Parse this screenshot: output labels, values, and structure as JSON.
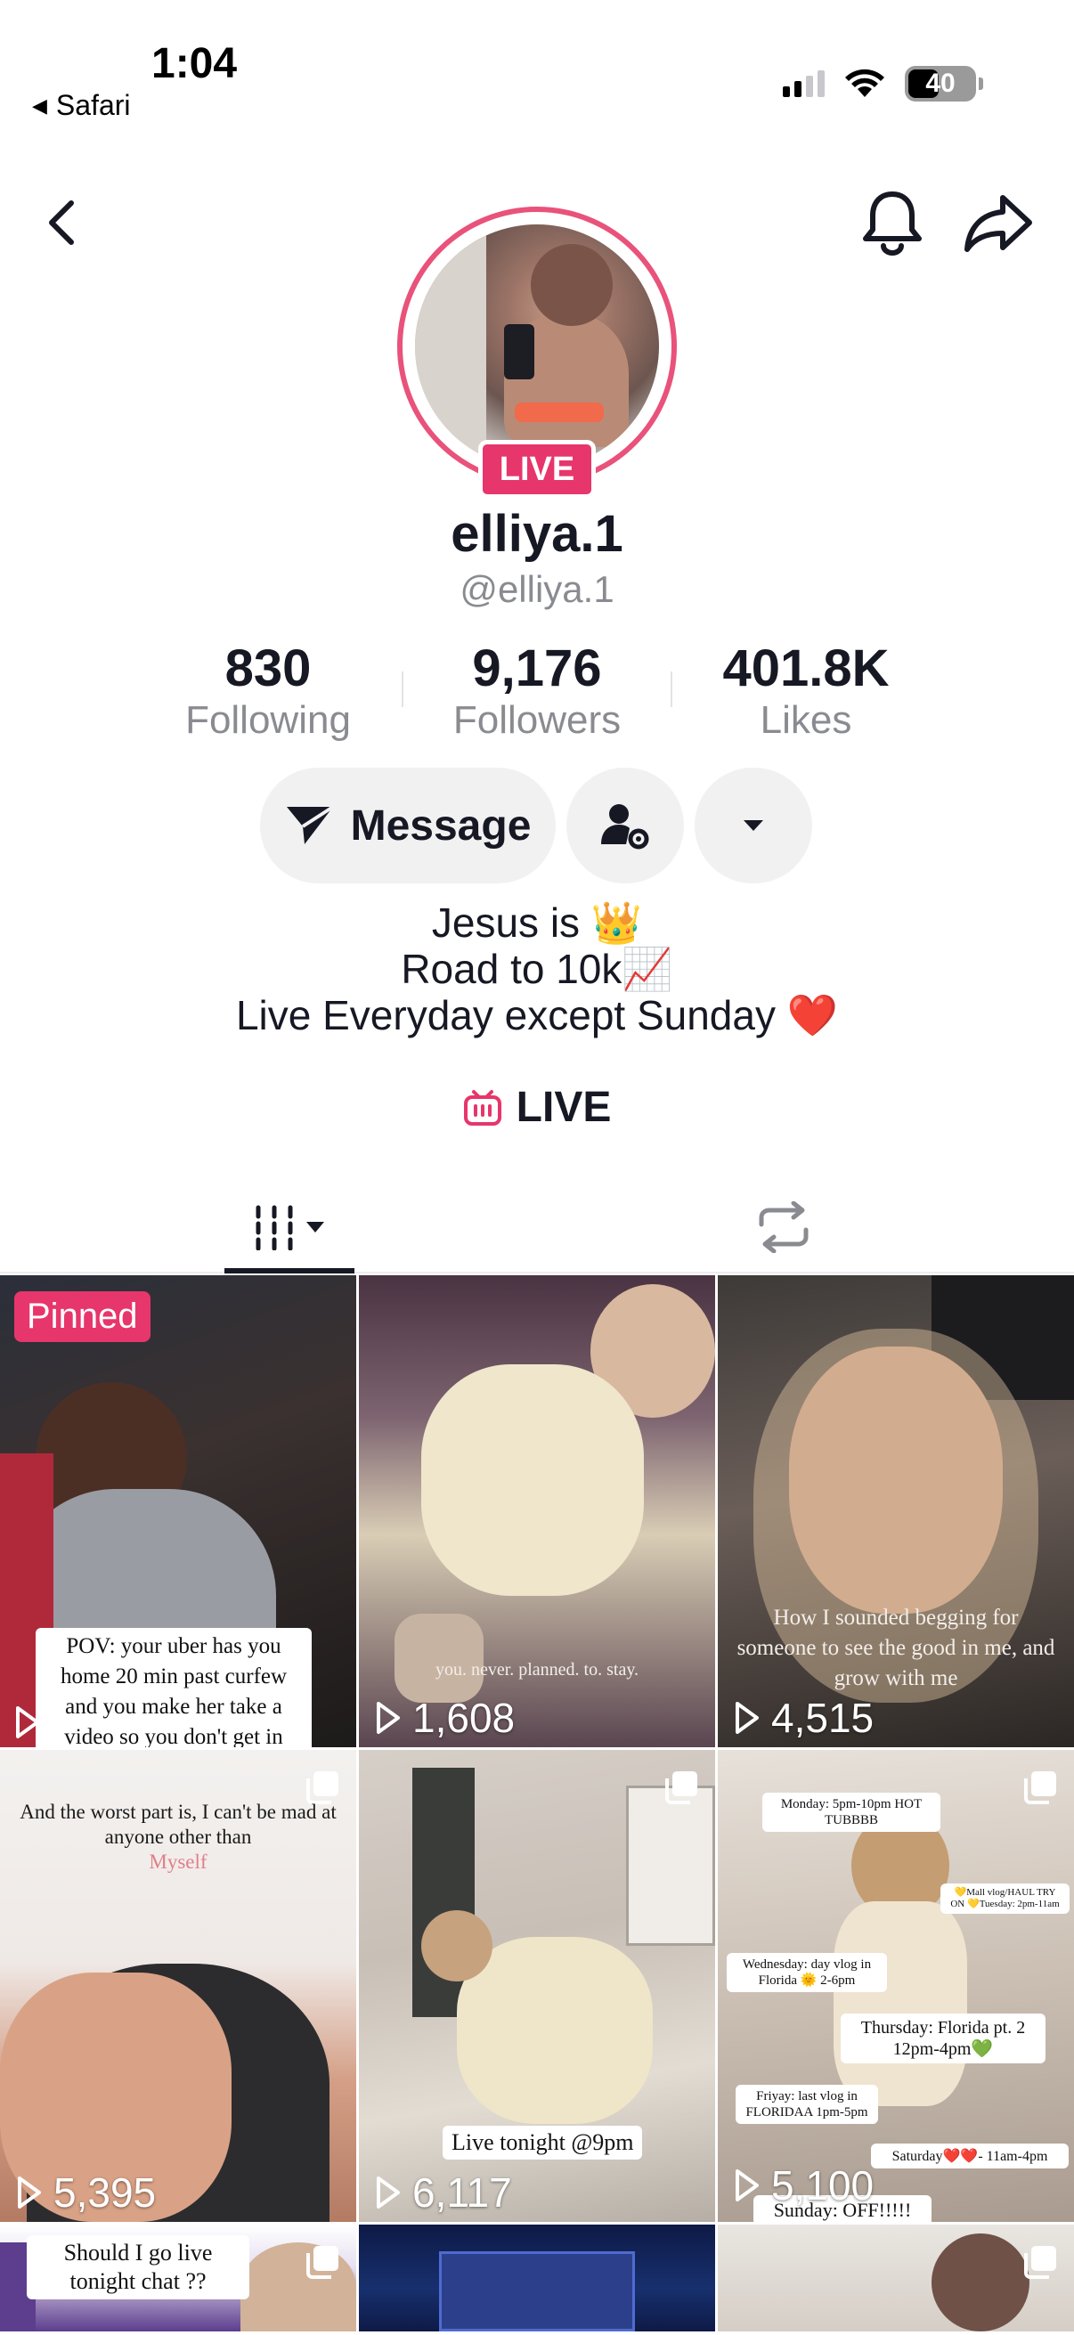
{
  "status_bar": {
    "time": "1:04",
    "back_app": "Safari",
    "battery": "40"
  },
  "profile": {
    "display_name": "elliya.1",
    "handle": "@elliya.1",
    "live_badge": "LIVE",
    "stats": [
      {
        "value": "830",
        "label": "Following"
      },
      {
        "value": "9,176",
        "label": "Followers"
      },
      {
        "value": "401.8K",
        "label": "Likes"
      }
    ],
    "message_label": "Message",
    "bio": [
      "Jesus is 👑",
      "Road to 10k📈",
      "Live Everyday except Sunday ❤️"
    ],
    "live_link": "LIVE"
  },
  "colors": {
    "accent": "#e7366c",
    "text": "#161823",
    "muted": "#8a8b91"
  },
  "videos": [
    {
      "pinned": "Pinned",
      "views": "",
      "caption": "POV: your uber has you home 20 min past curfew and you make her take a video so you don't get in"
    },
    {
      "views": "1,608",
      "caption": "you. never. planned. to. stay."
    },
    {
      "views": "4,515",
      "caption": "How I sounded begging for someone to see the good in me, and grow with me"
    },
    {
      "views": "5,395",
      "caption": "And the worst part is, I can't be mad at anyone other than",
      "caption_accent": "Myself"
    },
    {
      "views": "6,117",
      "caption": "Live tonight @9pm"
    },
    {
      "views": "5,100",
      "schedule": {
        "monday": "Monday: 5pm-10pm HOT TUBBBB",
        "tuesday": "💛Mall vlog/HAUL TRY ON 💛Tuesday: 2pm-11am",
        "wednesday": "Wednesday: day vlog in Florida 🌞 2-6pm",
        "thursday": "Thursday: Florida pt. 2 12pm-4pm💚",
        "friday": "Friyay: last vlog in FLORIDAA 1pm-5pm",
        "saturday": "Saturday❤️❤️- 11am-4pm",
        "sunday": "Sunday: OFF!!!!!"
      }
    },
    {
      "views": "",
      "caption": "Should I go live tonight chat ??"
    },
    {
      "views": "",
      "caption": ""
    },
    {
      "views": "",
      "caption": ""
    }
  ]
}
